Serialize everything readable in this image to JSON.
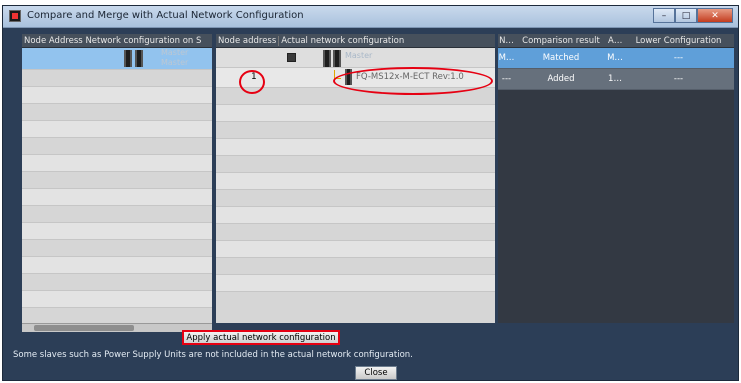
{
  "window": {
    "title": "Compare and Merge with Actual Network Configuration"
  },
  "left_pane": {
    "header": "Node Address Network configuration on S",
    "master_label": "Master",
    "master_label_2": "Master"
  },
  "middle_pane": {
    "header_node": "Node address",
    "header_config": "Actual network configuration",
    "master_label": "Master",
    "slave_node": "1",
    "slave_device": "FQ-MS12x-M-ECT Rev:1.0"
  },
  "right_pane": {
    "headers": [
      "N…",
      "Comparison result",
      "A…",
      "Lower Configuration"
    ],
    "rows": [
      [
        "M…",
        "Matched",
        "M…",
        "---"
      ],
      [
        "---",
        "Added",
        "1…",
        "---"
      ]
    ]
  },
  "apply_button": "Apply actual network configuration",
  "notice": "Some slaves such as Power Supply Units are not included in the actual network configuration.",
  "close_button": "Close",
  "colors": {
    "highlight": "#e60012",
    "selection": "#92c3ee",
    "matched": "#5f9fd9"
  }
}
